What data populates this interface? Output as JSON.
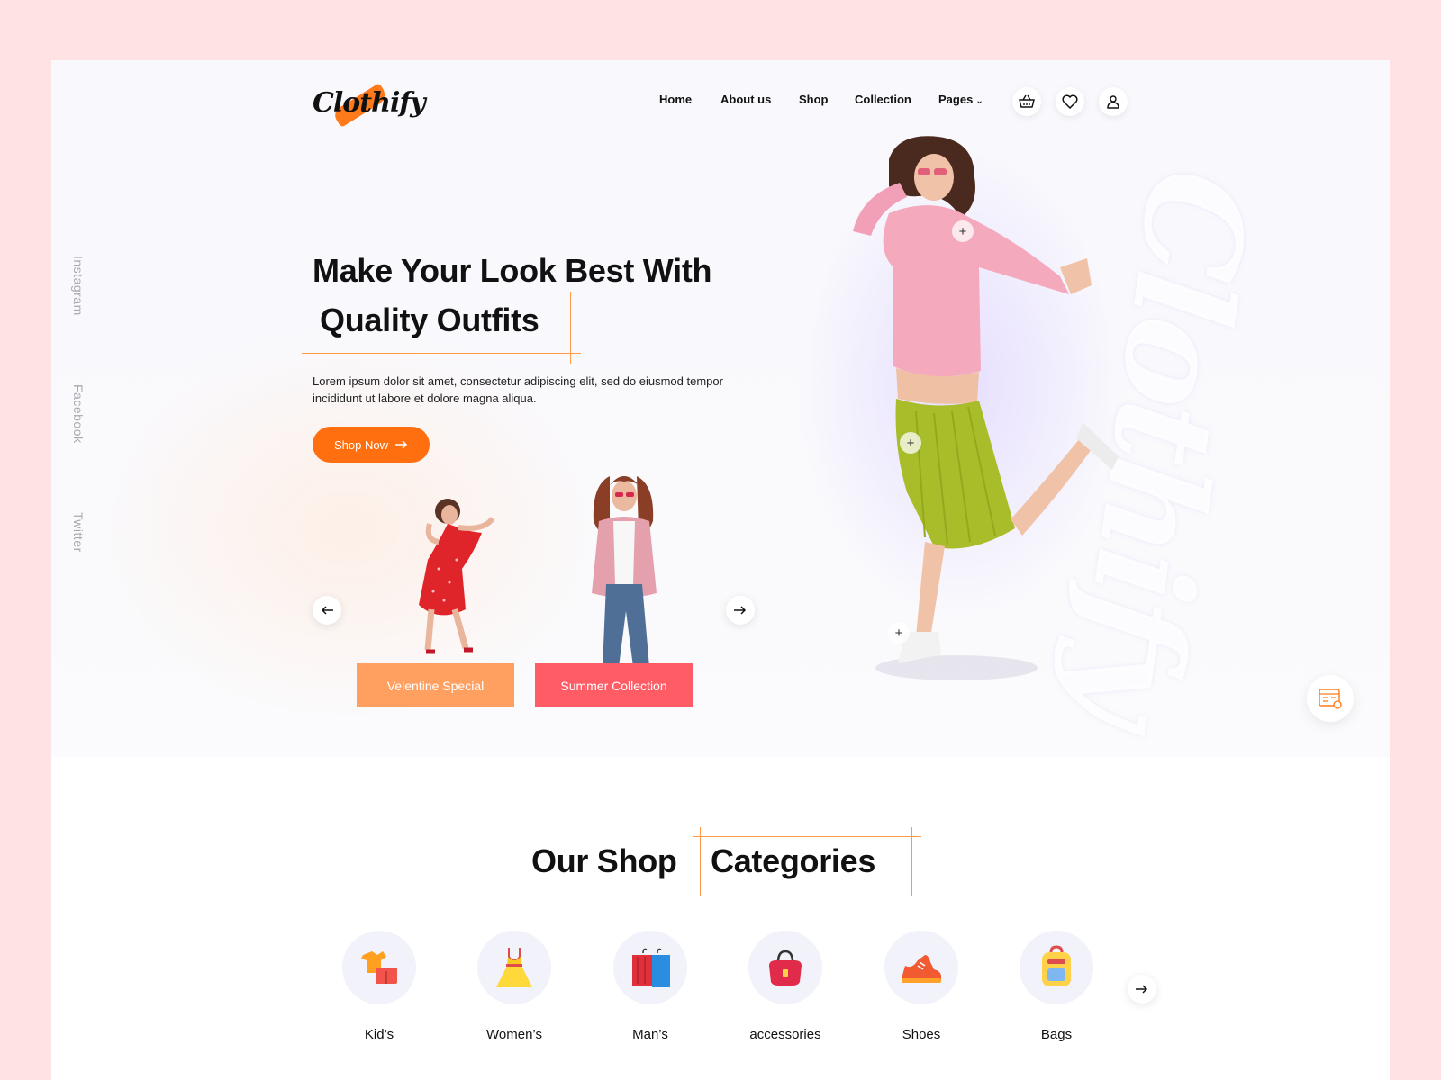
{
  "brand": {
    "logo_text": "Clothify",
    "watermark_text": "Clothify",
    "accent": "#ff6f0f"
  },
  "nav": {
    "items": [
      {
        "label": "Home"
      },
      {
        "label": "About us"
      },
      {
        "label": "Shop"
      },
      {
        "label": "Collection"
      },
      {
        "label": "Pages"
      }
    ],
    "icons": [
      "basket-icon",
      "heart-icon",
      "user-icon"
    ]
  },
  "social": {
    "items": [
      "Instagram",
      "Facebook",
      "Twitter"
    ]
  },
  "hero": {
    "headline_line1": "Make Your Look Best With",
    "headline_line2": "Quality Outfits",
    "description": "Lorem ipsum dolor sit amet, consectetur adipiscing elit, sed do eiusmod tempor incididunt ut labore et dolore magna aliqua.",
    "cta_label": "Shop Now"
  },
  "promos": [
    {
      "label": "Velentine Special",
      "color": "#ffa060"
    },
    {
      "label": "Summer Collection",
      "color": "#ff5c66"
    }
  ],
  "categories": {
    "title_part1": "Our Shop",
    "title_part2": "Categories",
    "items": [
      {
        "label": "Kid’s",
        "icon": "kids-clothes-icon"
      },
      {
        "label": "Women’s",
        "icon": "dress-icon"
      },
      {
        "label": "Man’s",
        "icon": "shirts-icon"
      },
      {
        "label": "accessories",
        "icon": "handbag-icon"
      },
      {
        "label": "Shoes",
        "icon": "sneaker-icon"
      },
      {
        "label": "Bags",
        "icon": "backpack-icon"
      }
    ]
  }
}
